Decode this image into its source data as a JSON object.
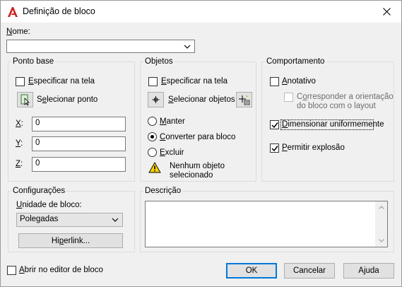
{
  "window": {
    "title": "Definição de bloco",
    "accent": "#cc1f1f"
  },
  "name": {
    "label": "Nome:",
    "value": ""
  },
  "base_point": {
    "title": "Ponto base",
    "specify_on_screen": "Especificar na tela",
    "pick_point": "Selecionar ponto",
    "x_label": "X:",
    "x_value": "0",
    "y_label": "Y:",
    "y_value": "0",
    "z_label": "Z:",
    "z_value": "0"
  },
  "objects": {
    "title": "Objetos",
    "specify_on_screen": "Especificar na tela",
    "select_objects": "Selecionar objetos",
    "retain": "Manter",
    "convert": "Converter para bloco",
    "delete": "Excluir",
    "warning": "Nenhum objeto selecionado",
    "selected_option": "convert"
  },
  "behavior": {
    "title": "Comportamento",
    "annotative": "Anotativo",
    "annotative_checked": false,
    "match_orientation": "Corresponder a orientação do bloco com o layout",
    "match_checked": false,
    "scale_uniformly": "Dimensionar uniformemente",
    "scale_checked": true,
    "allow_explode": "Permitir explosão",
    "explode_checked": true
  },
  "settings": {
    "title": "Configurações",
    "unit_label": "Unidade de bloco:",
    "unit_value": "Polegadas",
    "hyperlink": "Hiperlink..."
  },
  "description": {
    "title": "Descrição",
    "value": ""
  },
  "footer": {
    "open_in_editor": "Abrir no editor de bloco",
    "open_checked": false,
    "ok": "OK",
    "cancel": "Cancelar",
    "help": "Ajuda"
  }
}
